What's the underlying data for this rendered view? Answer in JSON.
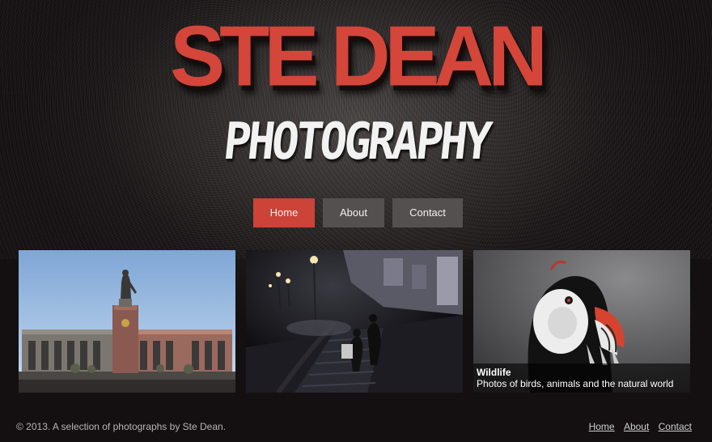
{
  "header": {
    "logo_title": "STE DEAN",
    "logo_subtitle": "PHOTOGRAPHY"
  },
  "nav": {
    "items": [
      {
        "label": "Home",
        "active": true
      },
      {
        "label": "About",
        "active": false
      },
      {
        "label": "Contact",
        "active": false
      }
    ]
  },
  "gallery": {
    "tiles": [
      {
        "subject": "monument"
      },
      {
        "subject": "night-stairs"
      },
      {
        "subject": "puffin",
        "caption_title": "Wildlife",
        "caption_text": "Photos of birds, animals and the natural world"
      }
    ]
  },
  "footer": {
    "copyright": "© 2013. A selection of photographs by Ste Dean.",
    "links": [
      "Home",
      "About",
      "Contact"
    ]
  },
  "colors": {
    "accent": "#cc4338",
    "nav_bg": "#555050",
    "page_bg": "#161213"
  }
}
